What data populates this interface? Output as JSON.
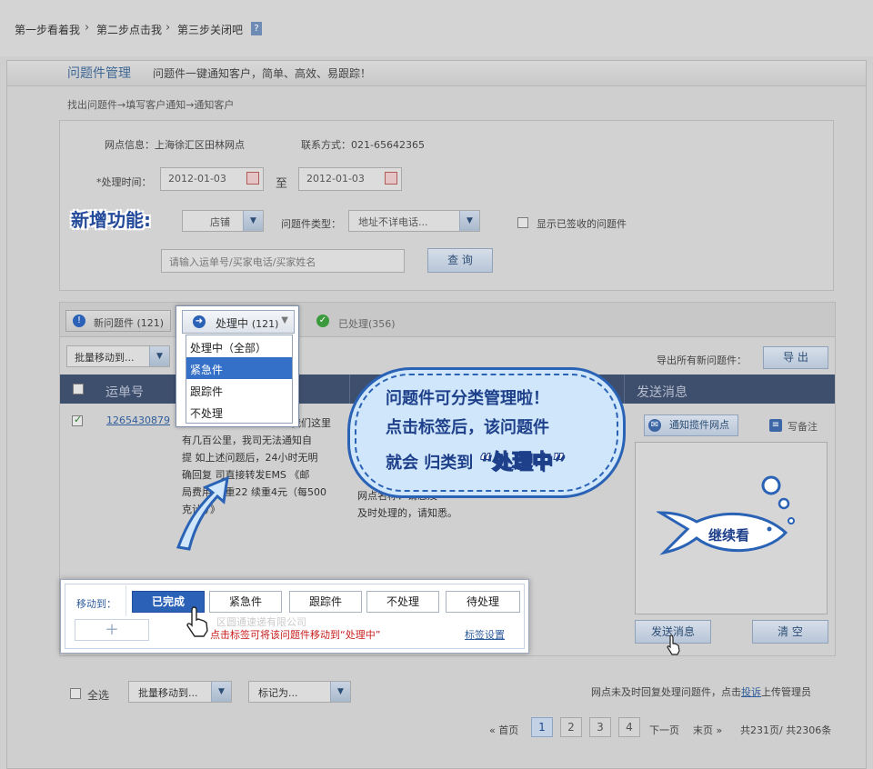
{
  "breadcrumb": {
    "step1": "第一步看着我",
    "step2": "第二步点击我",
    "step3": "第三步关闭吧",
    "help": "?"
  },
  "header": {
    "title": "问题件管理",
    "subtitle": "问题件一键通知客户，简单、高效、易跟踪！",
    "flow": "找出问题件→填写客户通知→通知客户"
  },
  "filter": {
    "site_label": "网点信息：上海徐汇区田林网点",
    "contact_label": "联系方式：021-65642365",
    "time_label": "*处理时间：",
    "date_from": "2012-01-03",
    "to_label": "至",
    "date_to": "2012-01-03",
    "shop_select": "店铺",
    "type_label": "问题件类型：",
    "type_select": "地址不详电话...",
    "show_signed_label": "显示已签收的问题件",
    "search_placeholder": "请输入运单号/买家电话/买家姓名",
    "query_button": "查 询"
  },
  "new_feature": "新增功能:",
  "tabs": {
    "new_label": "新问题件",
    "new_count": "(121)",
    "processing_label": "处理中",
    "processing_count": "(121)",
    "processed_label": "已处理",
    "processed_count": "(356)"
  },
  "dropdown": {
    "options": [
      "处理中（全部）",
      "紧急件",
      "跟踪件",
      "不处理"
    ],
    "selected": "紧急件"
  },
  "toolbar": {
    "batch_move": "批量移动到...",
    "export_label": "导出所有新问题件：",
    "export_button": "导 出"
  },
  "table": {
    "col_waybill": "运单号",
    "col_send": "发送消息",
    "row": {
      "waybill": "1265430879",
      "content_lines": [
        "我们这里",
        "有几百公里，我司无法通知自",
        "提  如上述问题后，24小时无明",
        "确回复  司直接转发EMS 《邮",
        "局费用  首重22 续重4元（每500",
        "克计  ）》"
      ],
      "notice_fragment": "网点名称：请您及",
      "notice_line2": "及时处理的，请知悉。",
      "notify_button": "通知揽件网点",
      "note_button": "写备注",
      "send_button": "发送消息",
      "clear_button": "清 空"
    }
  },
  "bubble": {
    "line1": "问题件可分类管理啦！",
    "line2": "点击标签后，该问题件",
    "line3_prefix": "就会 归类到",
    "line3_highlight": "“处理中”"
  },
  "fish_text": "继续看",
  "movebar": {
    "label": "移动到：",
    "buttons": [
      "已完成",
      "紧急件",
      "跟踪件",
      "不处理",
      "待处理"
    ],
    "add": "+",
    "hint": "点击标签可将该问题件移动到“处理中”",
    "settings_link": "标签设置",
    "company_ghost": "区圆通速递有限公司"
  },
  "footer": {
    "select_all": "全选",
    "batch_move": "批量移动到...",
    "mark_as": "标记为...",
    "notice_prefix": "网点未及时回复处理问题件，点击",
    "notice_link": "投诉",
    "notice_suffix": "上传管理员",
    "first": "« 首页",
    "pages": [
      "1",
      "2",
      "3",
      "4"
    ],
    "next": "下一页",
    "last": "末页 »",
    "summary": "共231页/ 共2306条"
  },
  "colors": {
    "accent": "#2b62b8",
    "table_header": "#3e4f6e",
    "title_blue": "#3e6795"
  }
}
